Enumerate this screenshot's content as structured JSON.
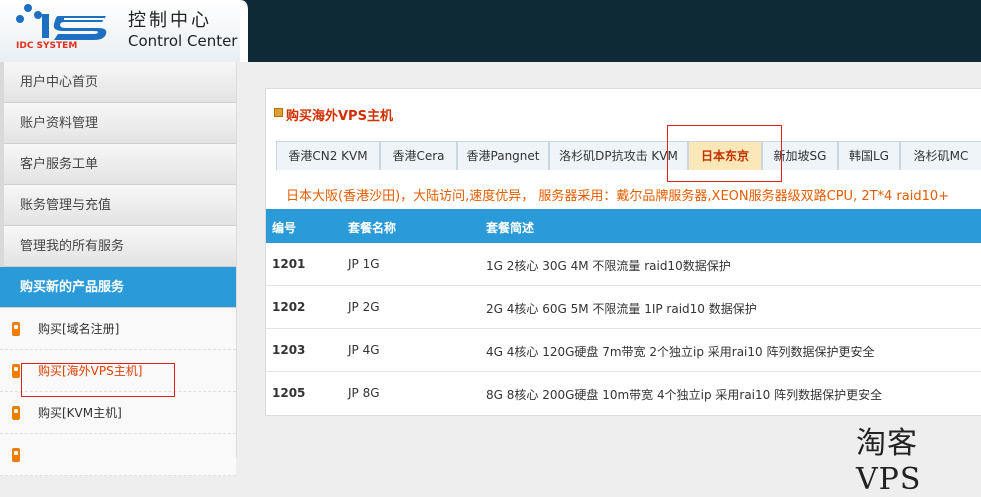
{
  "brand": {
    "logo_text": "IDC SYSTEM",
    "title": "控制中心",
    "subtitle": "Control Center"
  },
  "sidebar": {
    "items": [
      {
        "label": "用户中心首页"
      },
      {
        "label": "账户资料管理"
      },
      {
        "label": "客户服务工单"
      },
      {
        "label": "账务管理与充值"
      },
      {
        "label": "管理我的所有服务"
      },
      {
        "label": "购买新的产品服务"
      }
    ],
    "subitems": [
      {
        "label": "购买[域名注册]"
      },
      {
        "label": "购买[海外VPS主机]"
      },
      {
        "label": "购买[KVM主机]"
      }
    ]
  },
  "panel": {
    "title": "购买海外VPS主机",
    "tabs": [
      {
        "label": "香港CN2 KVM"
      },
      {
        "label": "香港Cera"
      },
      {
        "label": "香港Pangnet"
      },
      {
        "label": "洛杉矶DP抗攻击 KVM"
      },
      {
        "label": "日本东京"
      },
      {
        "label": "新加坡SG"
      },
      {
        "label": "韩国LG"
      },
      {
        "label": "洛杉矶MC"
      }
    ],
    "notice": "日本大阪(香港沙田)，大陆访问,速度优异， 服务器采用：戴尔品牌服务器,XEON服务器级双路CPU, 2T*4 raid10+",
    "table": {
      "headers": [
        "编号",
        "套餐名称",
        "套餐简述"
      ],
      "rows": [
        {
          "id": "1201",
          "name": "JP 1G",
          "desc": "1G 2核心 30G 4M 不限流量 raid10数据保护"
        },
        {
          "id": "1202",
          "name": "JP 2G",
          "desc": "2G 4核心 60G 5M 不限流量 1IP raid10 数据保护"
        },
        {
          "id": "1203",
          "name": "JP 4G",
          "desc": "4G 4核心 120G硬盘 7m带宽 2个独立ip 采用rai10 阵列数据保护更安全"
        },
        {
          "id": "1205",
          "name": "JP 8G",
          "desc": "8G 8核心 200G硬盘 10m带宽 4个独立ip 采用rai10 阵列数据保护更安全"
        }
      ]
    }
  },
  "watermark": "淘客VPS",
  "colors": {
    "header_dark": "#0f2a37",
    "accent_blue": "#2a9bd8",
    "notice_orange": "#e65c00",
    "highlight_red": "#e02020"
  }
}
